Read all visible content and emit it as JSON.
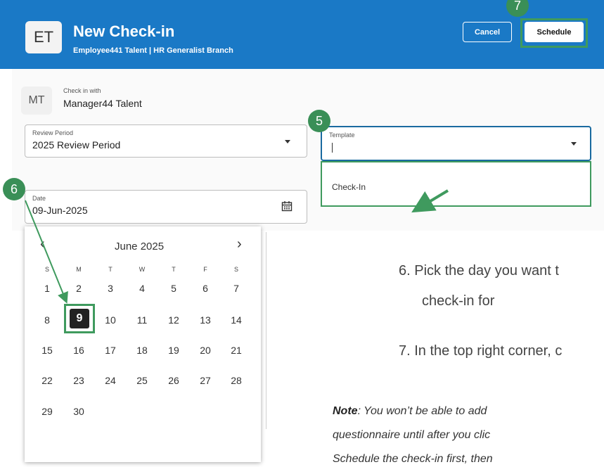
{
  "header": {
    "avatar": "ET",
    "title": "New Check-in",
    "subtitle": "Employee441 Talent | HR Generalist Branch",
    "cancel_label": "Cancel",
    "schedule_label": "Schedule"
  },
  "check_in_with": {
    "avatar": "MT",
    "label": "Check in with",
    "name": "Manager44 Talent"
  },
  "review_period": {
    "label": "Review Period",
    "value": "2025 Review Period"
  },
  "template": {
    "label": "Template",
    "value": "",
    "option": "Check-In"
  },
  "date_field": {
    "label": "Date",
    "value": "09-Jun-2025"
  },
  "calendar": {
    "month": "June 2025",
    "prev": "‹",
    "next": "›",
    "weekdays": [
      "S",
      "M",
      "T",
      "W",
      "T",
      "F",
      "S"
    ],
    "weeks": [
      [
        "1",
        "2",
        "3",
        "4",
        "5",
        "6",
        "7"
      ],
      [
        "8",
        "9",
        "10",
        "11",
        "12",
        "13",
        "14"
      ],
      [
        "15",
        "16",
        "17",
        "18",
        "19",
        "20",
        "21"
      ],
      [
        "22",
        "23",
        "24",
        "25",
        "26",
        "27",
        "28"
      ],
      [
        "29",
        "30"
      ]
    ],
    "selected": "9"
  },
  "steps": {
    "five": "5",
    "six": "6",
    "seven": "7"
  },
  "instructions": {
    "line1": "6.  Pick the day you want t",
    "line2": "check-in for",
    "line3": "7.  In the top right corner, c"
  },
  "note": {
    "bold": "Note",
    "line1_rest": ": You won’t be able to add",
    "line2": "questionnaire until after you clic",
    "line3": "Schedule the check-in first, then"
  },
  "colors": {
    "header": "#1a79c6",
    "highlight": "#3f9a5e",
    "badge": "#3a8f57"
  }
}
